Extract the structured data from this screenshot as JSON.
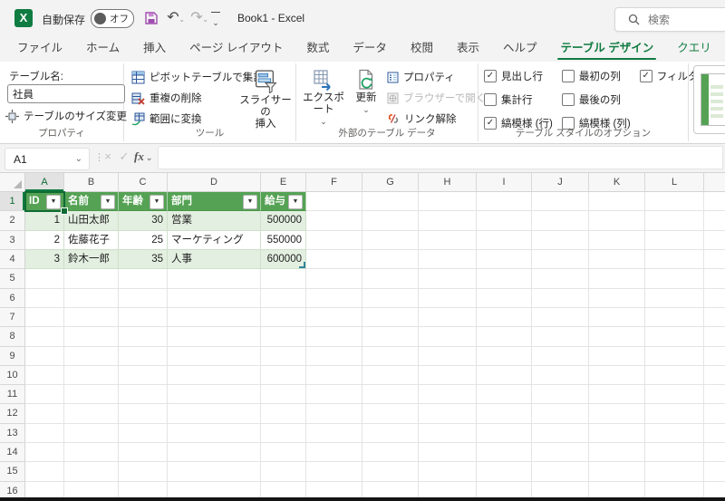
{
  "titlebar": {
    "autosave_label": "自動保存",
    "autosave_state": "オフ",
    "doc_title": "Book1 - Excel",
    "search_placeholder": "検索"
  },
  "tabs": [
    {
      "label": "ファイル",
      "active": false,
      "contextual": false
    },
    {
      "label": "ホーム",
      "active": false,
      "contextual": false
    },
    {
      "label": "挿入",
      "active": false,
      "contextual": false
    },
    {
      "label": "ページ レイアウト",
      "active": false,
      "contextual": false
    },
    {
      "label": "数式",
      "active": false,
      "contextual": false
    },
    {
      "label": "データ",
      "active": false,
      "contextual": false
    },
    {
      "label": "校閲",
      "active": false,
      "contextual": false
    },
    {
      "label": "表示",
      "active": false,
      "contextual": false
    },
    {
      "label": "ヘルプ",
      "active": false,
      "contextual": false
    },
    {
      "label": "テーブル デザイン",
      "active": true,
      "contextual": true
    },
    {
      "label": "クエリ",
      "active": false,
      "contextual": true
    }
  ],
  "ribbon": {
    "properties_group": {
      "label": "プロパティ",
      "table_name_label": "テーブル名:",
      "table_name_value": "社員",
      "resize_button": "テーブルのサイズ変更"
    },
    "tools_group": {
      "label": "ツール",
      "pivot_button": "ピボットテーブルで集計",
      "dedupe_button": "重複の削除",
      "range_button": "範囲に変換",
      "slicer_button": [
        "スライサーの",
        "挿入"
      ]
    },
    "external_group": {
      "label": "外部のテーブル データ",
      "export_button": "エクスポート",
      "refresh_button": "更新",
      "properties_button": "プロパティ",
      "browser_button": "ブラウザーで開く",
      "unlink_button": "リンク解除"
    },
    "style_options_group": {
      "label": "テーブル スタイルのオプション",
      "checkboxes": [
        {
          "label": "見出し行",
          "checked": true
        },
        {
          "label": "集計行",
          "checked": false
        },
        {
          "label": "縞模様 (行)",
          "checked": true
        },
        {
          "label": "最初の列",
          "checked": false
        },
        {
          "label": "最後の列",
          "checked": false
        },
        {
          "label": "縞模様 (列)",
          "checked": false
        },
        {
          "label": "フィルター ボタン",
          "checked": true
        }
      ]
    }
  },
  "formula_bar": {
    "name_box": "A1",
    "fx_label": "fx",
    "formula_value": ""
  },
  "sheet": {
    "column_headers": [
      "A",
      "B",
      "C",
      "D",
      "E",
      "F",
      "G",
      "H",
      "I",
      "J",
      "K",
      "L"
    ],
    "row_headers": [
      "1",
      "2",
      "3",
      "4",
      "5",
      "6",
      "7",
      "8",
      "9",
      "10",
      "11",
      "12",
      "13",
      "14",
      "15",
      "16"
    ],
    "selection": "A1",
    "table": {
      "headers": [
        "ID",
        "名前",
        "年齢",
        "部門",
        "給与"
      ],
      "rows": [
        [
          "1",
          "山田太郎",
          "30",
          "営業",
          "500000"
        ],
        [
          "2",
          "佐藤花子",
          "25",
          "マーケティング",
          "550000"
        ],
        [
          "3",
          "鈴木一郎",
          "35",
          "人事",
          "600000"
        ]
      ]
    }
  },
  "colors": {
    "accent_green": "#107c41",
    "table_header_green": "#55a255",
    "band_green": "#e3efe0",
    "save_icon_purple": "#a04bb0"
  }
}
